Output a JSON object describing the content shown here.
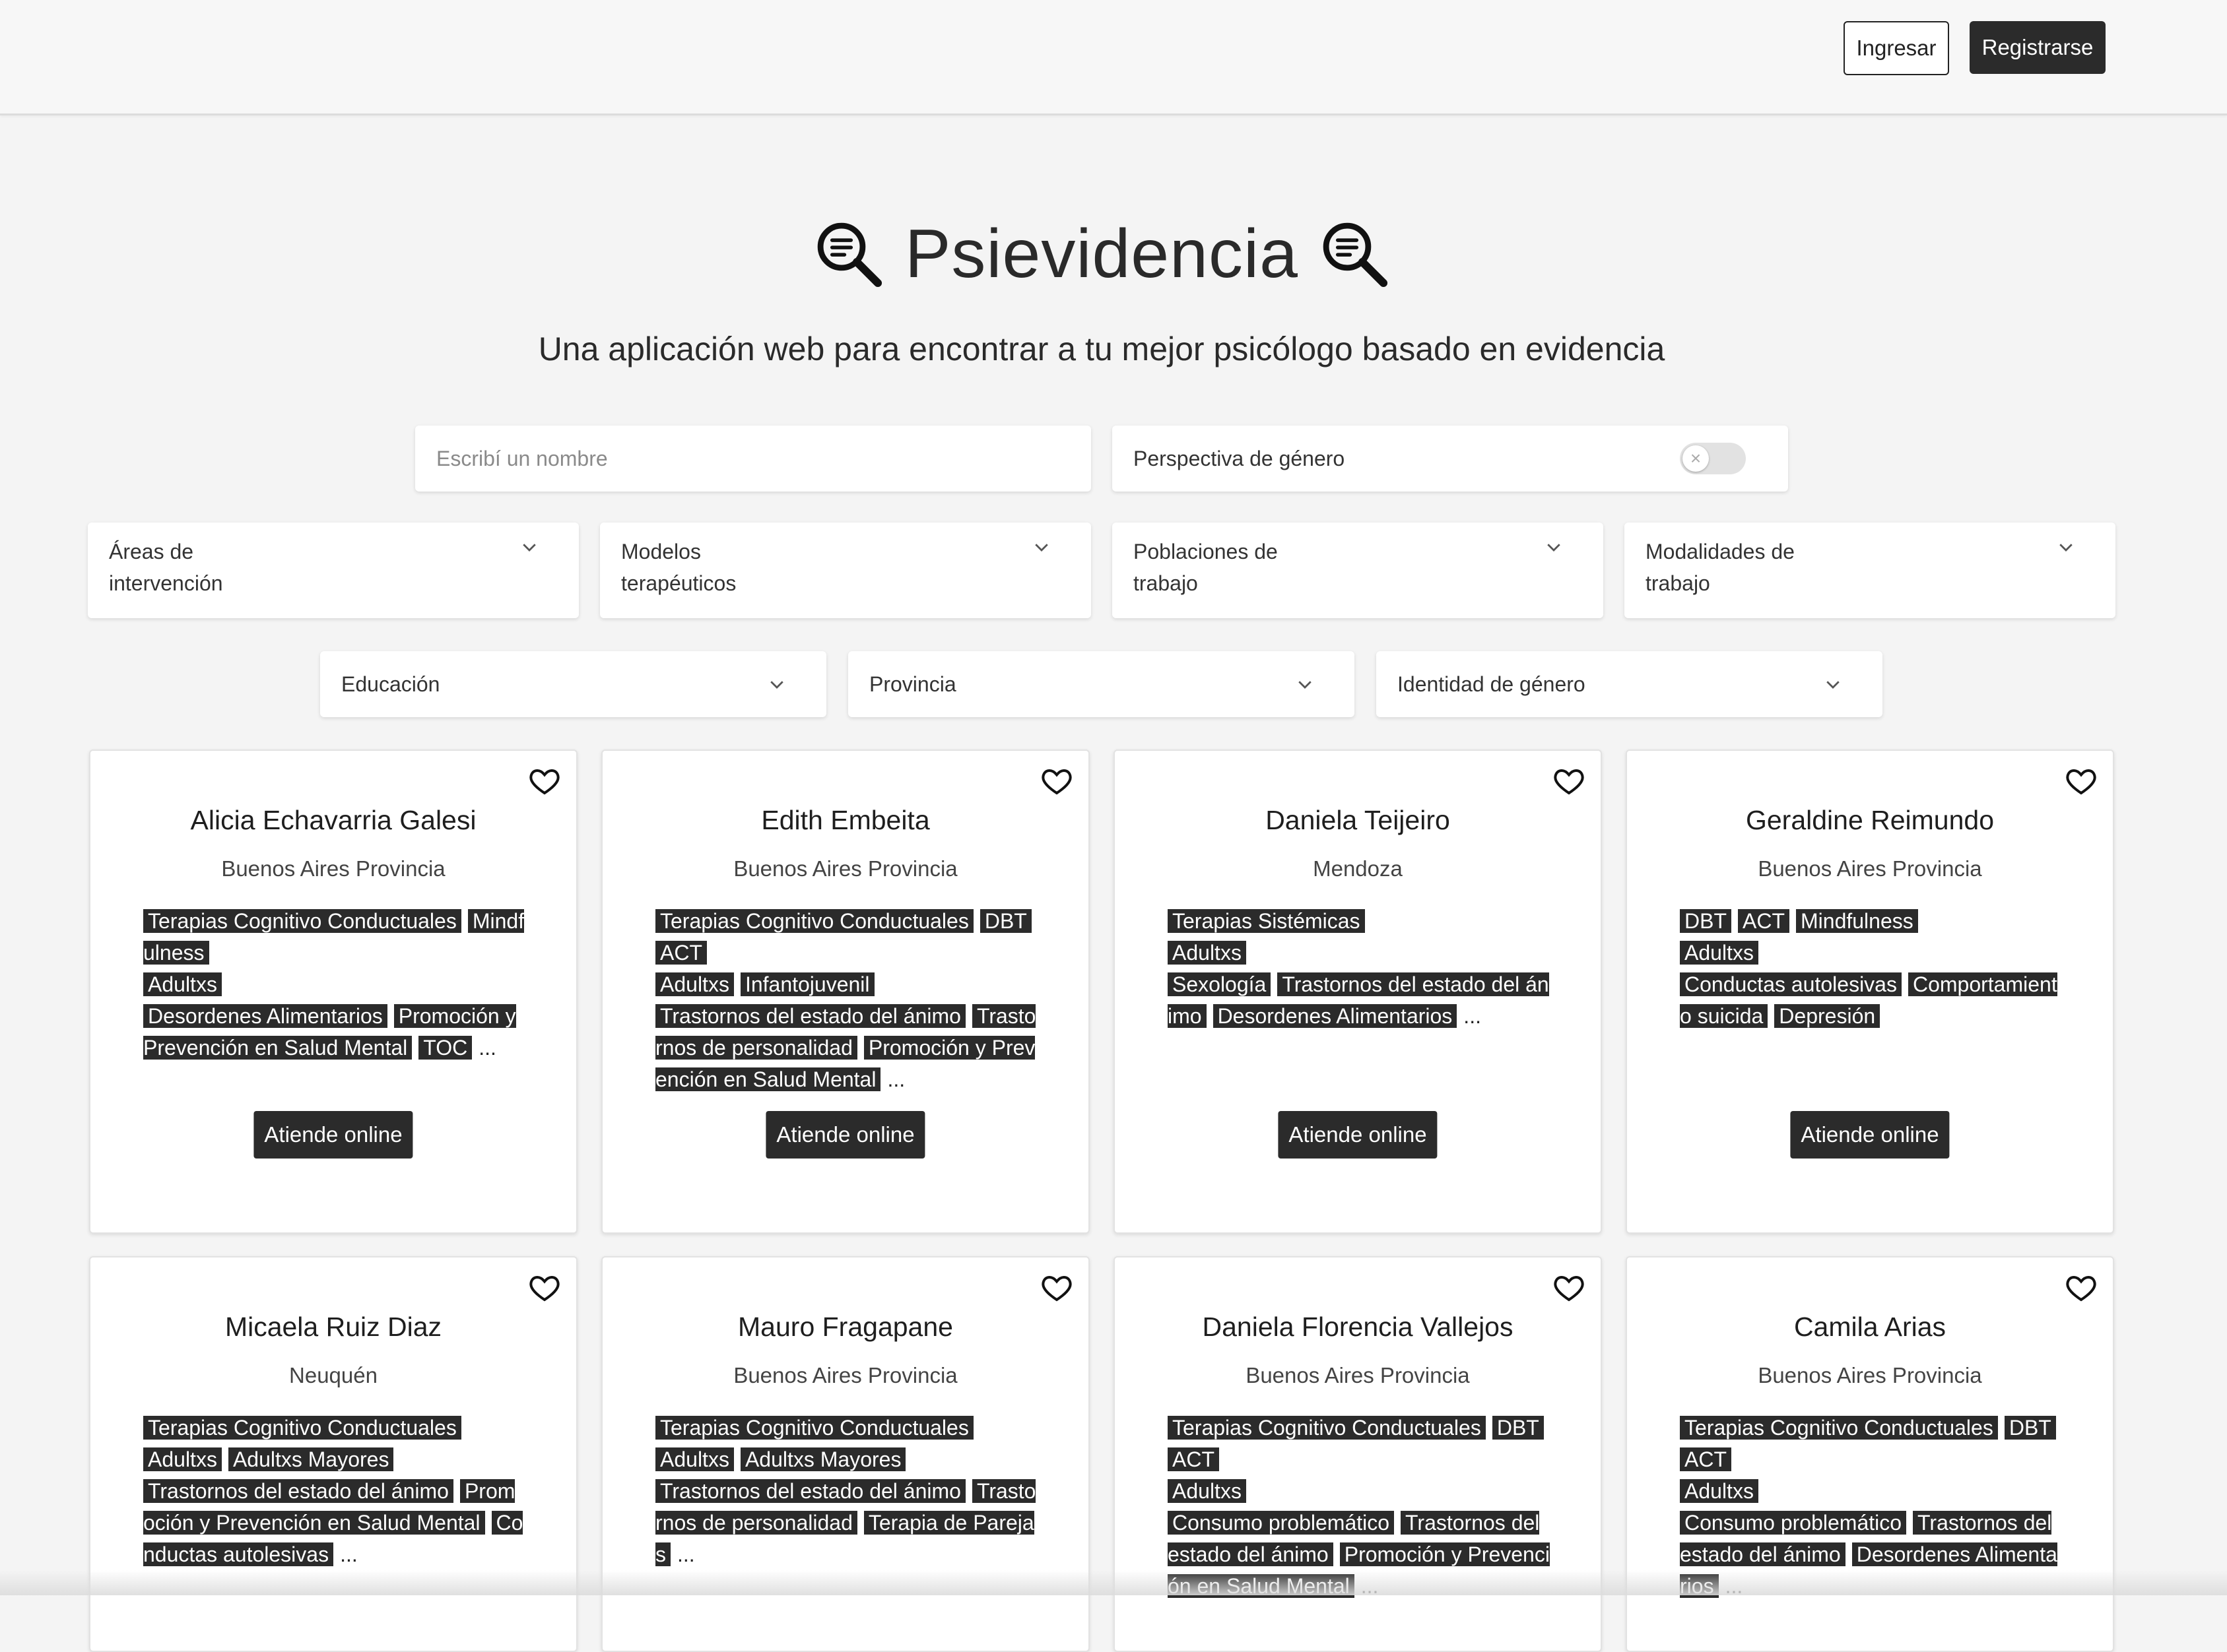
{
  "header": {
    "login_label": "Ingresar",
    "register_label": "Registrarse"
  },
  "hero": {
    "title": "Psievidencia",
    "subtitle": "Una aplicación web para encontrar a tu mejor psicólogo basado en evidencia",
    "icon": "magnifier-icon"
  },
  "filters": {
    "search_placeholder": "Escribí un nombre",
    "gender_perspective_label": "Perspectiva de género",
    "gender_perspective_on": false,
    "dropdowns_row1": [
      {
        "line1": "Áreas de",
        "line2": "intervención"
      },
      {
        "line1": "Modelos",
        "line2": "terapéuticos"
      },
      {
        "line1": "Poblaciones de",
        "line2": "trabajo"
      },
      {
        "line1": "Modalidades de",
        "line2": "trabajo"
      }
    ],
    "dropdowns_row2": [
      {
        "label": "Educación"
      },
      {
        "label": "Provincia"
      },
      {
        "label": "Identidad de género"
      }
    ]
  },
  "cards": [
    {
      "name": "Alicia Echavarria Galesi",
      "province": "Buenos Aires Provincia",
      "lines": [
        [
          "Terapias Cognitivo Conductuales",
          "Mindfulness"
        ],
        [
          "Adultxs"
        ],
        [
          "Desordenes Alimentarios",
          "Promoción y Prevención en Salud Mental",
          "TOC"
        ]
      ],
      "more": "...",
      "online_label": "Atiende online"
    },
    {
      "name": "Edith Embeita",
      "province": "Buenos Aires Provincia",
      "lines": [
        [
          "Terapias Cognitivo Conductuales",
          "DBT",
          "ACT"
        ],
        [
          "Adultxs",
          "Infantojuvenil"
        ],
        [
          "Trastornos del estado del ánimo",
          "Trastornos de personalidad",
          "Promoción y Prevención en Salud Mental"
        ]
      ],
      "more": "...",
      "online_label": "Atiende online"
    },
    {
      "name": "Daniela Teijeiro",
      "province": "Mendoza",
      "lines": [
        [
          "Terapias Sistémicas"
        ],
        [
          "Adultxs"
        ],
        [
          "Sexología",
          "Trastornos del estado del ánimo",
          "Desordenes Alimentarios"
        ]
      ],
      "more": "...",
      "online_label": "Atiende online"
    },
    {
      "name": "Geraldine Reimundo",
      "province": "Buenos Aires Provincia",
      "lines": [
        [
          "DBT",
          "ACT",
          "Mindfulness"
        ],
        [
          "Adultxs"
        ],
        [
          "Conductas autolesivas",
          "Comportamiento suicida",
          "Depresión"
        ]
      ],
      "more": "",
      "online_label": "Atiende online"
    },
    {
      "name": "Micaela Ruiz Diaz",
      "province": "Neuquén",
      "lines": [
        [
          "Terapias Cognitivo Conductuales"
        ],
        [
          "Adultxs",
          "Adultxs Mayores"
        ],
        [
          "Trastornos del estado del ánimo",
          "Promoción y Prevención en Salud Mental",
          "Conductas autolesivas"
        ]
      ],
      "more": "...",
      "online_label": ""
    },
    {
      "name": "Mauro Fragapane",
      "province": "Buenos Aires Provincia",
      "lines": [
        [
          "Terapias Cognitivo Conductuales"
        ],
        [
          "Adultxs",
          "Adultxs Mayores"
        ],
        [
          "Trastornos del estado del ánimo",
          "Trastornos de personalidad",
          "Terapia de Parejas"
        ]
      ],
      "more": "...",
      "online_label": ""
    },
    {
      "name": "Daniela Florencia Vallejos",
      "province": "Buenos Aires Provincia",
      "lines": [
        [
          "Terapias Cognitivo Conductuales",
          "DBT",
          "ACT"
        ],
        [
          "Adultxs"
        ],
        [
          "Consumo problemático",
          "Trastornos del estado del ánimo",
          "Promoción y Prevención en Salud Mental"
        ]
      ],
      "more": "...",
      "online_label": ""
    },
    {
      "name": "Camila Arias",
      "province": "Buenos Aires Provincia",
      "lines": [
        [
          "Terapias Cognitivo Conductuales",
          "DBT",
          "ACT"
        ],
        [
          "Adultxs"
        ],
        [
          "Consumo problemático",
          "Trastornos del estado del ánimo",
          "Desordenes Alimentarios"
        ]
      ],
      "more": "...",
      "online_label": ""
    }
  ]
}
